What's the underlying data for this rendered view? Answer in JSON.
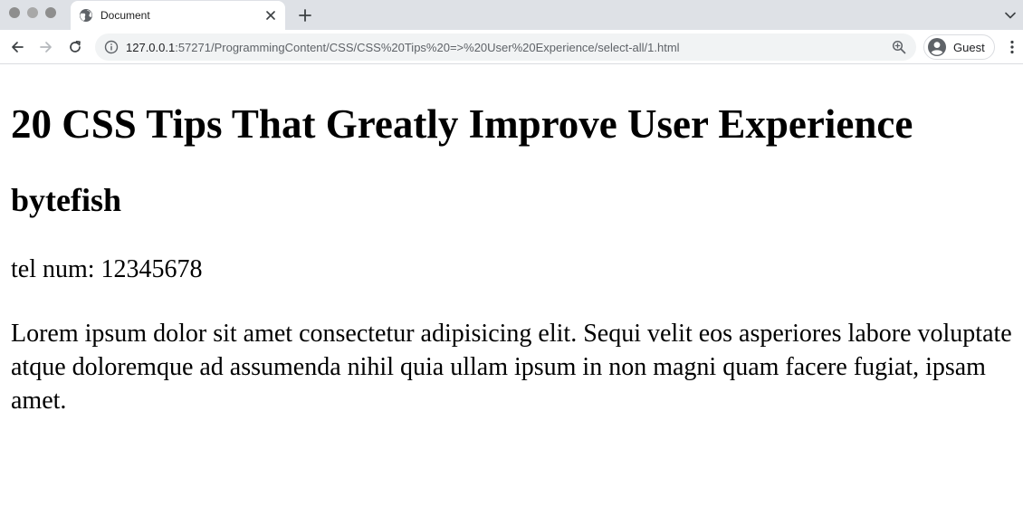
{
  "browser": {
    "tab": {
      "title": "Document"
    },
    "address_bar": {
      "host": "127.0.0.1",
      "rest": ":57271/ProgrammingContent/CSS/CSS%20Tips%20=>%20User%20Experience/select-all/1.html"
    },
    "profile": {
      "label": "Guest"
    },
    "icons": {
      "close": "close-icon",
      "new_tab": "plus-icon",
      "back": "arrow-left-icon",
      "forward": "arrow-right-icon",
      "reload": "reload-icon",
      "site_info": "info-icon",
      "zoom": "zoom-icon",
      "menu": "kebab-menu-icon"
    }
  },
  "page": {
    "heading": "20 CSS Tips That Greatly Improve User Experience",
    "author": "bytefish",
    "phone": "tel num: 12345678",
    "body": "Lorem ipsum dolor sit amet consectetur adipisicing elit. Sequi velit eos asperiores labore voluptate atque doloremque ad assumenda nihil quia ullam ipsum in non magni quam facere fugiat, ipsam amet."
  }
}
